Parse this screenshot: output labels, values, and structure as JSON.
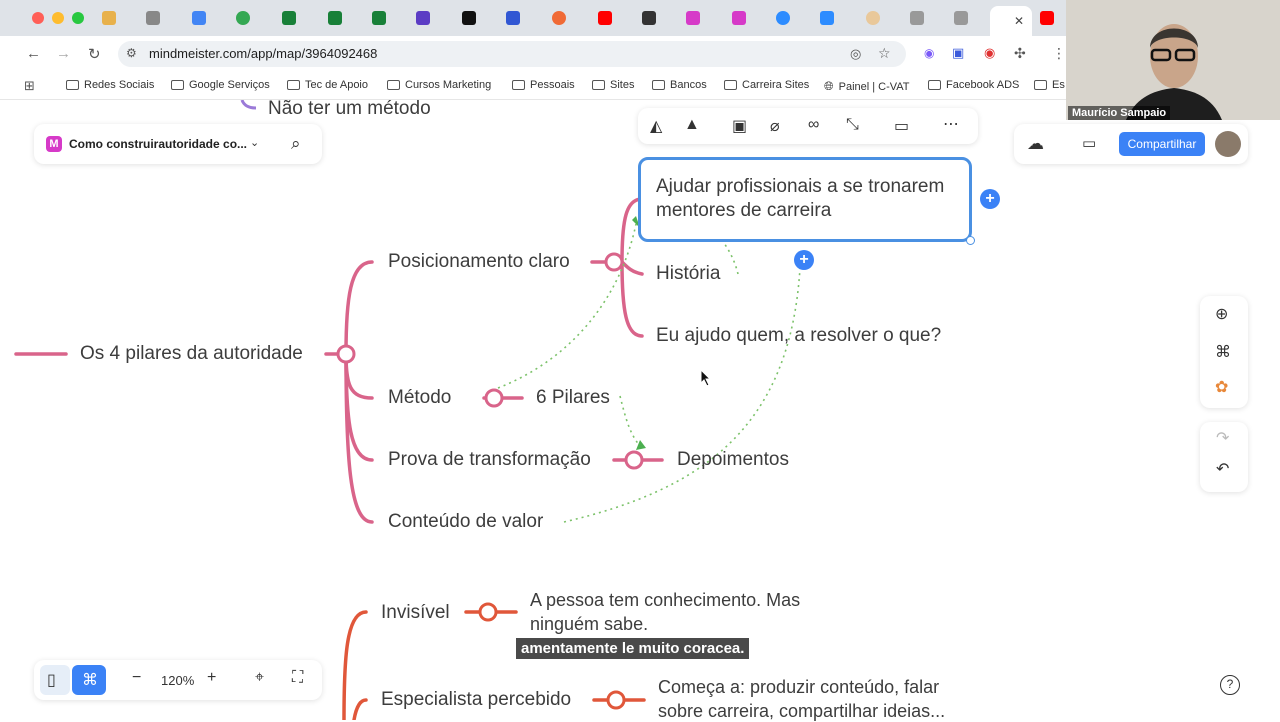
{
  "browser": {
    "url": "mindmeister.com/app/map/3964092468",
    "bookmarks": [
      "Redes Sociais",
      "Google Serviços",
      "Tec de Apoio",
      "Cursos Marketing",
      "Pessoais",
      "Sites",
      "Bancos",
      "Carreira Sites",
      "Painel | C-VAT",
      "Facebook ADS",
      "Es"
    ]
  },
  "map": {
    "title": "Como construirautoridade co...",
    "share_label": "Compartilhar",
    "zoom": "120%",
    "top_partial_node": "Não ter um método",
    "root": "Os 4 pilares da autoridade",
    "branches": {
      "positioning": "Posicionamento claro",
      "method": "Método",
      "proof": "Prova de transformação",
      "content": "Conteúdo de valor"
    },
    "children": {
      "selected_line1": "Ajudar profissionais a se tronarem",
      "selected_line2": "mentores de carreira",
      "history": "História",
      "i_help": "Eu ajudo quem, a resolver o que?",
      "pillars": "6 Pilares",
      "testimonials": "Depoimentos"
    },
    "lower": {
      "invisible": "Invisível",
      "invisible_desc1": "A pessoa tem conhecimento. Mas",
      "invisible_desc2": "ninguém sabe.",
      "perceived": "Especialista percebido",
      "perceived_desc1": "Começa a: produzir conteúdo, falar",
      "perceived_desc2": "sobre carreira, compartilhar ideias..."
    }
  },
  "video": {
    "participant": "Maurício Sampaio",
    "caption": "amentamente le muito coracea."
  },
  "colors": {
    "pink": "#d9648a",
    "orange": "#e0573a",
    "accent": "#3b82f6"
  }
}
